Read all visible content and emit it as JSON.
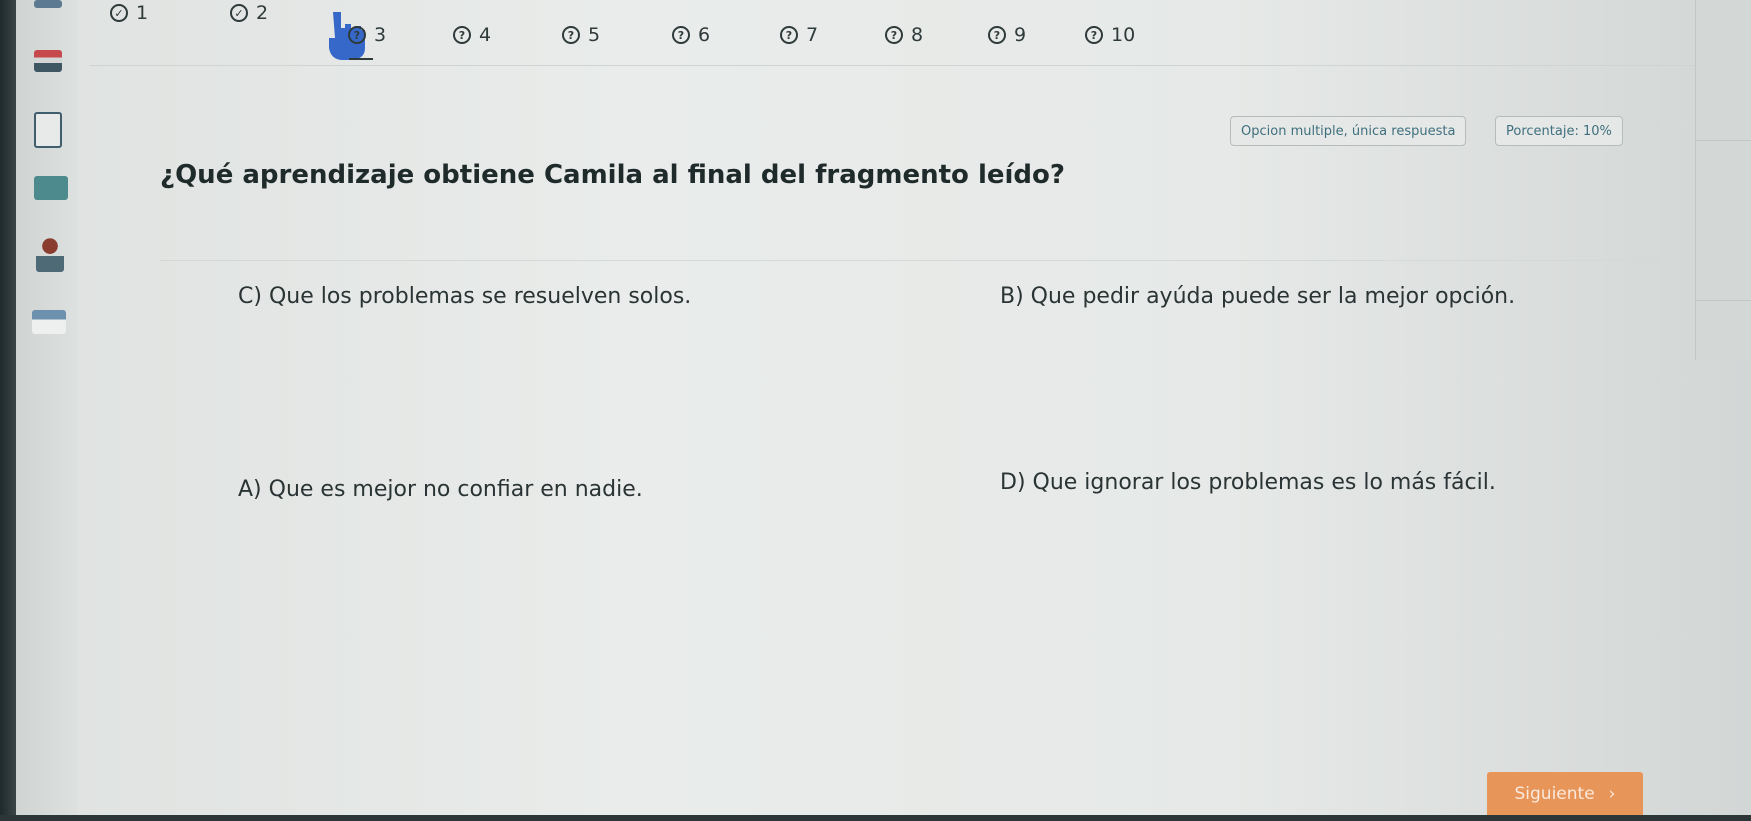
{
  "question_nav": {
    "items": [
      {
        "label": "1",
        "status": "answered"
      },
      {
        "label": "2",
        "status": "answered"
      },
      {
        "label": "3",
        "status": "unanswered"
      },
      {
        "label": "4",
        "status": "unanswered"
      },
      {
        "label": "5",
        "status": "unanswered"
      },
      {
        "label": "6",
        "status": "unanswered"
      },
      {
        "label": "7",
        "status": "unanswered"
      },
      {
        "label": "8",
        "status": "unanswered"
      },
      {
        "label": "9",
        "status": "unanswered"
      },
      {
        "label": "10",
        "status": "unanswered"
      }
    ],
    "unanswered_glyph": "?",
    "answered_glyph": "✓"
  },
  "badges": {
    "type": "Opcion multiple, única respuesta",
    "score": "Porcentaje: 10%"
  },
  "question": {
    "text": "¿Qué aprendizaje obtiene Camila al final del fragmento leído?"
  },
  "options": {
    "c": "C) Que los problemas se resuelven solos.",
    "b": "B) Que pedir ayúda puede ser la mejor opción.",
    "a": "A) Que es mejor no confiar en nadie.",
    "d": "D) Que ignorar los problemas es lo más fácil."
  },
  "footer": {
    "next_label": "Siguiente",
    "next_icon": "›"
  },
  "colors": {
    "accent": "#e8955a",
    "badge_text": "#3f6f7e",
    "text": "#1f2a2a"
  }
}
